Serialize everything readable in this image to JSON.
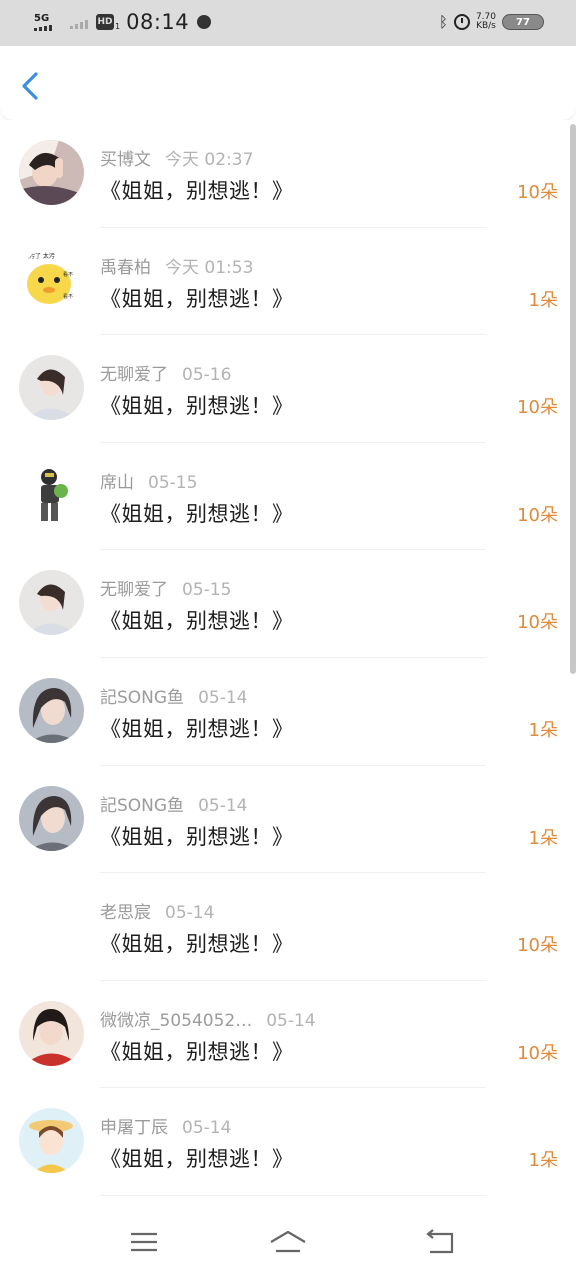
{
  "status_bar": {
    "network": "5G",
    "hd": "HD",
    "hd_sub": "1",
    "time": "08:14",
    "speed_value": "7.70",
    "speed_unit": "KB/s",
    "battery": "77"
  },
  "header": {
    "back_icon": "chevron-left-icon"
  },
  "colors": {
    "accent": "#3a8ee6",
    "count": "#e08a3a",
    "name": "#9b9b9b"
  },
  "items": [
    {
      "name": "买博文",
      "time": "今天 02:37",
      "title": "《姐姐，别想逃！》",
      "count": "10朵"
    },
    {
      "name": "禹春柏",
      "time": "今天 01:53",
      "title": "《姐姐，别想逃！》",
      "count": "1朵"
    },
    {
      "name": "无聊爱了",
      "time": "05-16",
      "title": "《姐姐，别想逃！》",
      "count": "10朵"
    },
    {
      "name": "席山",
      "time": "05-15",
      "title": "《姐姐，别想逃！》",
      "count": "10朵"
    },
    {
      "name": "无聊爱了",
      "time": "05-15",
      "title": "《姐姐，别想逃！》",
      "count": "10朵"
    },
    {
      "name": "記SONG鱼",
      "time": "05-14",
      "title": "《姐姐，别想逃！》",
      "count": "1朵"
    },
    {
      "name": "記SONG鱼",
      "time": "05-14",
      "title": "《姐姐，别想逃！》",
      "count": "1朵"
    },
    {
      "name": "老思宸",
      "time": "05-14",
      "title": "《姐姐，别想逃！》",
      "count": "10朵"
    },
    {
      "name": "微微凉_5054052…",
      "time": "05-14",
      "title": "《姐姐，别想逃！》",
      "count": "10朵"
    },
    {
      "name": "申屠丁辰",
      "time": "05-14",
      "title": "《姐姐，别想逃！》",
      "count": "1朵"
    }
  ],
  "nav": {
    "menu_icon": "menu-icon",
    "home_icon": "home-icon",
    "back_icon": "return-icon"
  }
}
